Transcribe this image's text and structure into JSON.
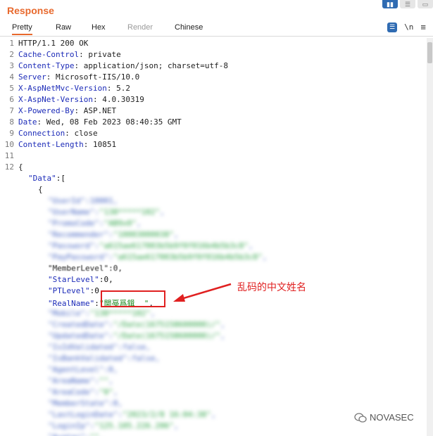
{
  "panel": {
    "title": "Response"
  },
  "tabs": [
    {
      "label": "Pretty"
    },
    {
      "label": "Raw"
    },
    {
      "label": "Hex"
    },
    {
      "label": "Render"
    },
    {
      "label": "Chinese"
    }
  ],
  "toolbar": {
    "newline_label": "\\n",
    "menu_glyph": "≡"
  },
  "view_toggle_icons": [
    "split-horizontal-icon",
    "split-vertical-icon",
    "single-pane-icon"
  ],
  "colors": {
    "accent": "#e8692d",
    "header_key": "#1c2bb8",
    "string_value": "#1e8a1e",
    "annotation": "#e02020",
    "toggle_active": "#2f6bb2"
  },
  "headers": [
    {
      "key": "HTTP/1.1 200 OK",
      "value": ""
    },
    {
      "key": "Cache-Control",
      "value": " private"
    },
    {
      "key": "Content-Type",
      "value": " application/json; charset=utf-8"
    },
    {
      "key": "Server",
      "value": " Microsoft-IIS/10.0"
    },
    {
      "key": "X-AspNetMvc-Version",
      "value": " 5.2"
    },
    {
      "key": "X-AspNet-Version",
      "value": " 4.0.30319"
    },
    {
      "key": "X-Powered-By",
      "value": " ASP.NET"
    },
    {
      "key": "Date",
      "value": " Wed, 08 Feb 2023 08:40:35 GMT"
    },
    {
      "key": "Connection",
      "value": " close"
    },
    {
      "key": "Content-Length",
      "value": " 10851"
    }
  ],
  "line_numbers": [
    "1",
    "2",
    "3",
    "4",
    "5",
    "6",
    "7",
    "8",
    "9",
    "10",
    "11",
    "12"
  ],
  "json_body": {
    "open_brace": "{",
    "data_key": "\"Data\"",
    "data_open": ":[",
    "item_open": "{",
    "member_level": "\"MemberLevel\":0,",
    "star_level_key": "\"StarLevel\"",
    "star_level_val": ":0,",
    "pt_level_key": "\"PTLevel\"",
    "pt_level_val": ":0,",
    "realname_key": "\"RealName\"",
    "realname_colon": ":",
    "realname_value": "\"閫戞爲鍓  \"",
    "realname_comma": ","
  },
  "annotation": {
    "text": "乱码的中文姓名"
  },
  "watermark": {
    "text": "NOVASEC"
  }
}
